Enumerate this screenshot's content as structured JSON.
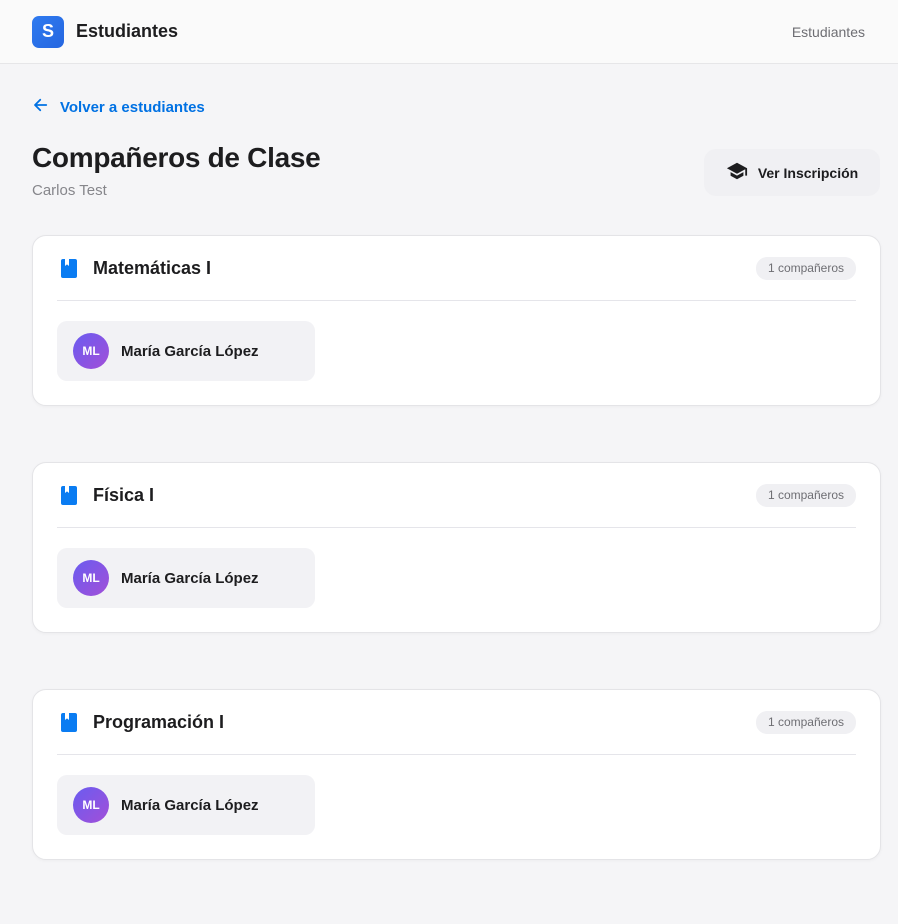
{
  "header": {
    "logo_letter": "S",
    "app_name": "Estudiantes",
    "nav_link": "Estudiantes"
  },
  "back_link": {
    "label": "Volver a estudiantes",
    "icon": "arrow-left-icon"
  },
  "page": {
    "title": "Compañeros de Clase",
    "student": "Carlos Test",
    "enroll_button": "Ver Inscripción",
    "enroll_icon": "graduation-cap-icon"
  },
  "colors": {
    "accent": "#0071e3",
    "avatar_gradient": [
      "#6a5cf0",
      "#a24fd8"
    ]
  },
  "courses": [
    {
      "name": "Matemáticas I",
      "count": "1 compañeros",
      "classmates": [
        {
          "initials": "ML",
          "name": "María García López"
        }
      ]
    },
    {
      "name": "Física I",
      "count": "1 compañeros",
      "classmates": [
        {
          "initials": "ML",
          "name": "María García López"
        }
      ]
    },
    {
      "name": "Programación I",
      "count": "1 compañeros",
      "classmates": [
        {
          "initials": "ML",
          "name": "María García López"
        }
      ]
    }
  ]
}
